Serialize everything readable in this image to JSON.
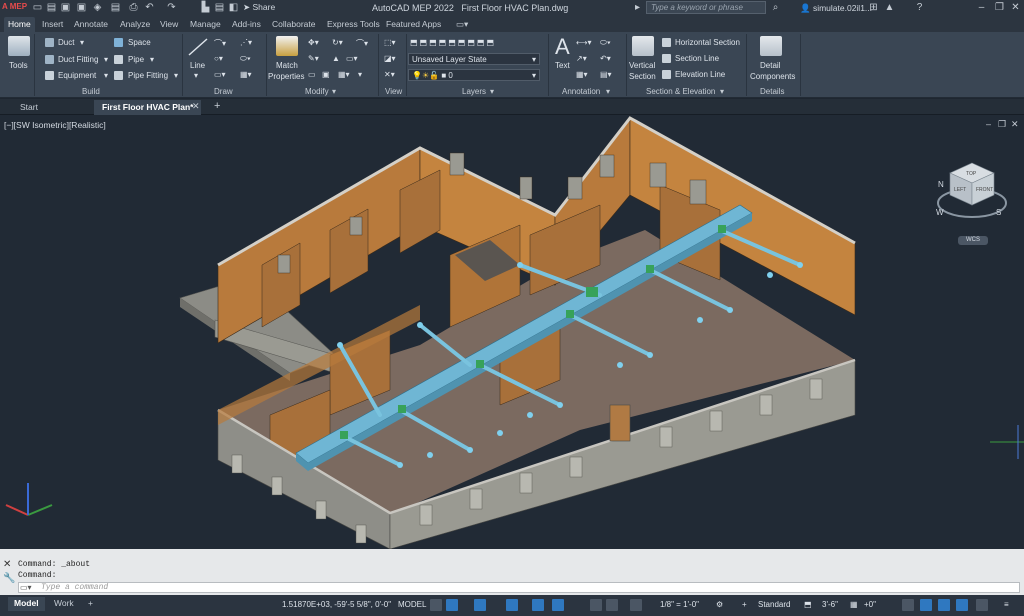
{
  "app": {
    "title": "AutoCAD MEP 2022",
    "file": "First Floor HVAC Plan.dwg",
    "logo": "A MEP",
    "share": "Share",
    "search_placeholder": "Type a keyword or phrase",
    "user": "simulate.02il1..."
  },
  "ribbon_tabs": [
    "Home",
    "Insert",
    "Annotate",
    "Analyze",
    "View",
    "Manage",
    "Add-ins",
    "Collaborate",
    "Express Tools",
    "Featured Apps"
  ],
  "ribbon": {
    "tools": "Tools",
    "build": {
      "items": [
        "Duct",
        "Duct Fitting",
        "Equipment",
        "Space",
        "Pipe",
        "Pipe Fitting"
      ],
      "panel": "Build"
    },
    "draw": {
      "line": "Line",
      "panel": "Draw"
    },
    "modify": {
      "match": "Match",
      "properties": "Properties",
      "panel": "Modify"
    },
    "view": {
      "panel": "View"
    },
    "layers": {
      "state": "Unsaved Layer State",
      "layer": "0",
      "panel": "Layers"
    },
    "annotation": {
      "text": "Text",
      "panel": "Annotation"
    },
    "section": {
      "vertical": "Vertical",
      "section": "Section",
      "items": [
        "Horizontal Section",
        "Section Line",
        "Elevation Line"
      ],
      "panel": "Section & Elevation"
    },
    "details": {
      "detail": "Detail",
      "components": "Components",
      "panel": "Details"
    }
  },
  "doc_tabs": [
    {
      "label": "Start",
      "active": false
    },
    {
      "label": "First Floor HVAC Plan*",
      "active": true
    }
  ],
  "viewport": {
    "label": "[−][SW Isometric][Realistic]",
    "viewcube": {
      "top": "TOP",
      "left": "LEFT",
      "front": "FRONT",
      "n": "N",
      "w": "W",
      "s": "S"
    },
    "ucs": "WCS"
  },
  "command": {
    "history": [
      "Command: _about",
      "Command:"
    ],
    "placeholder": "Type a command"
  },
  "status": {
    "layouts": [
      "Model",
      "Work"
    ],
    "coords": "1.51870E+03, -59'-5 5/8\", 0'-0\"",
    "mode": "MODEL",
    "scale": "1/8\" = 1'-0\"",
    "style": "Standard",
    "elev": "3'-6\"",
    "ang": "+0\""
  },
  "colors": {
    "accent": "#3a8ad6",
    "duct": "#6fb6d4",
    "wall": "#b87a3c",
    "floor": "#6e5f55",
    "exterior": "#9a9a92"
  }
}
